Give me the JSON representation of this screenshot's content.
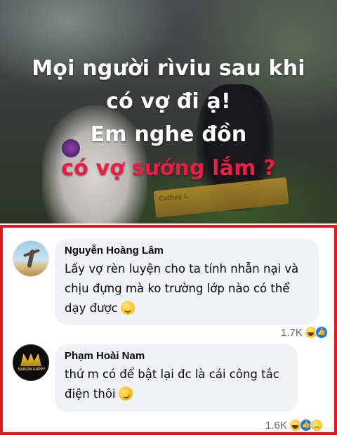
{
  "banner": {
    "lines": [
      "Mọi người rìviu sau khi",
      "có vợ đi ạ!",
      "Em nghe đồn",
      "có vợ sướng lắm ?"
    ],
    "bench_text": "Cathay L",
    "title_color": "#ffffff",
    "highlight_color": "#ee1c44"
  },
  "frame_color": "#e6161d",
  "comments": [
    {
      "author": "Nguyễn Hoàng Lâm",
      "text": "Lấy vợ rèn luyện cho ta tính nhẫn nại và chịu đựng mà ko trường lớp nào có thể dạy được",
      "emoji": "slightly-smiling-face",
      "reaction_count": "1.7K",
      "reactions": [
        "haha",
        "like"
      ]
    },
    {
      "author": "Phạm Hoài Nam",
      "avatar_text": "SAIGON GUPPY",
      "text": "thứ m có để bật lại đc là cái công tắc điện thôi",
      "emoji": "rolling-on-floor-laughing",
      "reaction_count": "1.6K",
      "reactions": [
        "haha",
        "like",
        "sad"
      ]
    }
  ]
}
